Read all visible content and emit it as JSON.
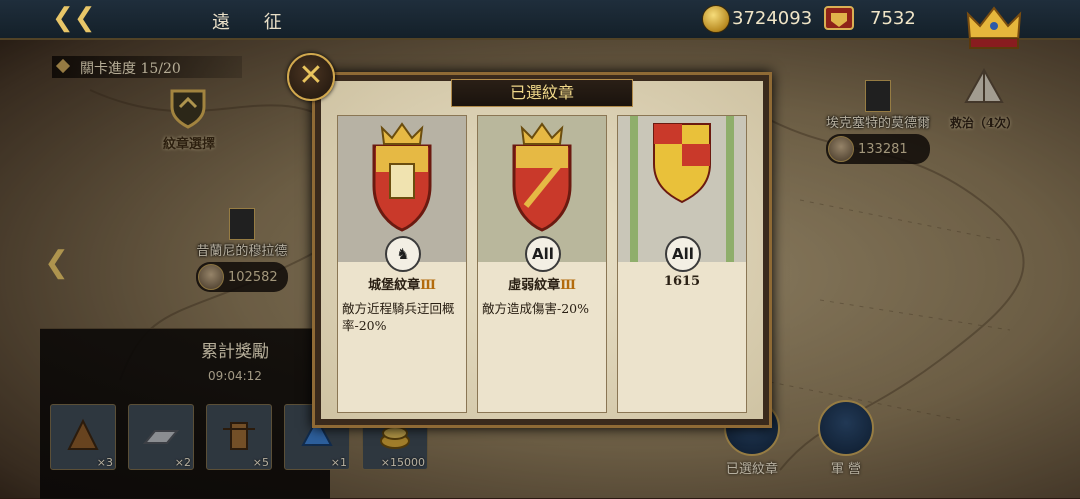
{
  "header": {
    "title": "遠 征",
    "gold": "3724093",
    "crest_points": "7532"
  },
  "stage_progress": "關卡進度 15/20",
  "emblem_select_label": "紋章選擇",
  "npcs": [
    {
      "name": "昔蘭尼的穆拉德",
      "power": "102582"
    },
    {
      "name": "埃克塞特的莫德爾",
      "power": "133281"
    }
  ],
  "tent_label": "救治（4次）",
  "rewards": {
    "title": "累計獎勵",
    "timer": "09:04:12",
    "items": [
      {
        "icon": "catapult-icon",
        "count": "×3"
      },
      {
        "icon": "iron-ingot-icon",
        "count": "×2"
      },
      {
        "icon": "siege-tower-icon",
        "count": "×5"
      },
      {
        "icon": "blue-crystal-icon",
        "count": "×1"
      },
      {
        "icon": "gold-coins-icon",
        "count": "×15000"
      }
    ]
  },
  "bottom_buttons": [
    {
      "label": "已選紋章"
    },
    {
      "label": "軍 營"
    }
  ],
  "modal": {
    "title": "已選紋章",
    "cards": [
      {
        "name": "城堡紋章",
        "tier": "Ⅲ",
        "badge": "♞",
        "desc": "敵方近程騎兵迂回概率-20%"
      },
      {
        "name": "虛弱紋章",
        "tier": "Ⅲ",
        "badge": "All",
        "desc": "敵方造成傷害-20%"
      },
      {
        "name": "1615",
        "tier": "",
        "badge": "All",
        "desc": ""
      }
    ]
  },
  "colors": {
    "gold_accent": "#e8c668",
    "tier_color": "#b36b0c",
    "header_bg": "#1f2e3c"
  }
}
